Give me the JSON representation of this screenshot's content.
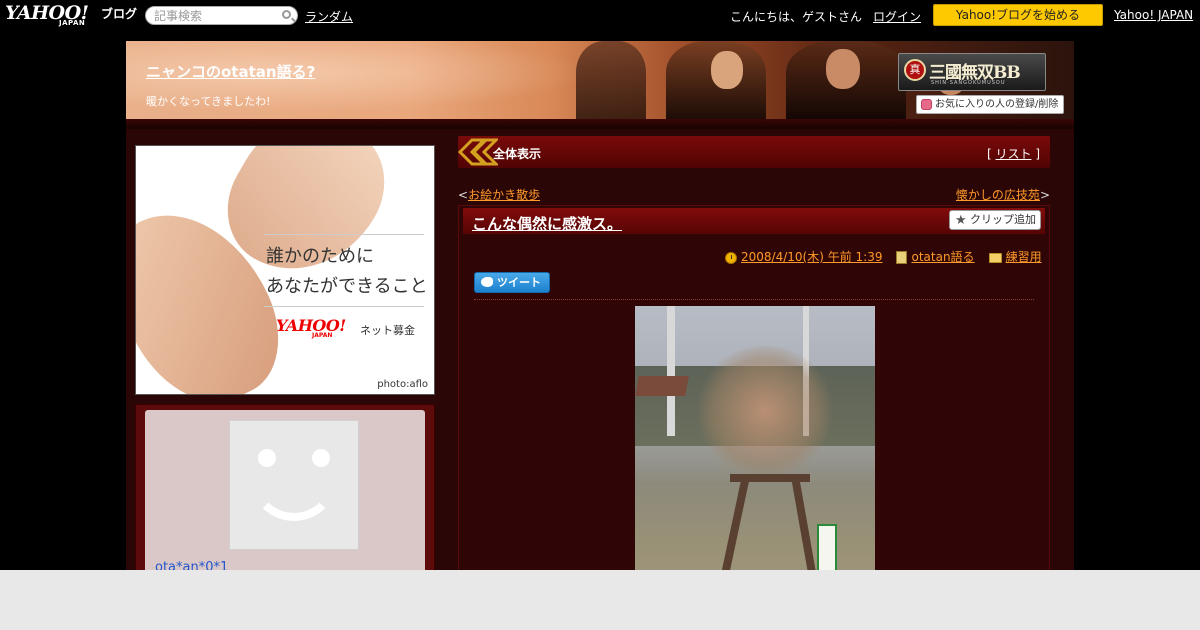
{
  "topbar": {
    "logo_text": "YAHOO!",
    "logo_japan": "JAPAN",
    "logo_blog": "ブログ",
    "search_placeholder": "記事検索",
    "random_link": "ランダム",
    "greeting": "こんにちは、ゲストさん",
    "login_link": "ログイン",
    "start_button": "Yahoo!ブログを始める",
    "yahoo_japan_link": "Yahoo! JAPAN"
  },
  "header": {
    "blog_title": "ニャンコのotatan語る?",
    "blog_description": "暖かくなってきましたわ!",
    "game_logo_seal": "真",
    "game_logo_name": "三國無双BB",
    "game_logo_sub": "SHIN·SANGOKUMUSOU",
    "favorite_button": "お気に入りの人の登録/削除"
  },
  "sidebar": {
    "ad": {
      "line1": "誰かのために",
      "line2": "あなたができること",
      "brand": "YAHOO!",
      "brand_japan": "JAPAN",
      "service": "ネット募金",
      "credit": "photo:aflo"
    },
    "profile": {
      "nickname": "ota*an*0*1"
    }
  },
  "content": {
    "section_title": "全体表示",
    "list_link": "リスト",
    "nav_prev": "お絵かき散歩",
    "nav_next": "懐かしの広技苑",
    "article": {
      "title": "こんな偶然に感激ス。",
      "clip_button": "クリップ追加",
      "date": "2008/4/10(木) 午前 1:39",
      "author": "otatan語る",
      "category": "練習用",
      "tweet_button": "ツイート"
    }
  },
  "colors": {
    "accent_orange": "#ff9a2a",
    "start_button_yellow": "#ffc900",
    "header_red": "#7a0a0a"
  }
}
